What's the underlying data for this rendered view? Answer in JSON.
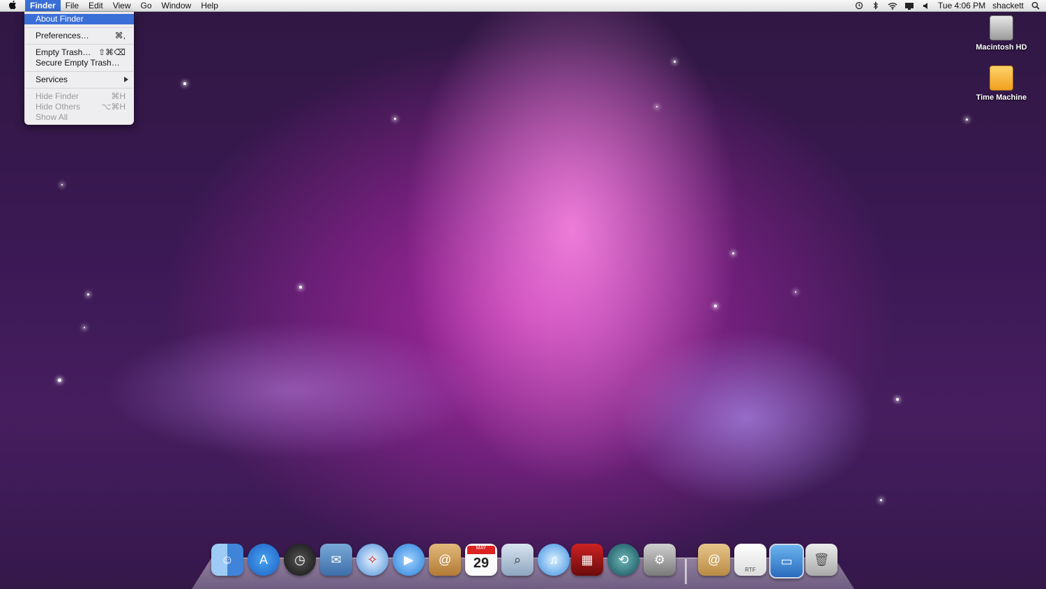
{
  "menubar": {
    "apple": "",
    "items": [
      "Finder",
      "File",
      "Edit",
      "View",
      "Go",
      "Window",
      "Help"
    ],
    "clock": "Tue 4:06 PM",
    "user": "shackett",
    "status_icons": [
      "time-machine-icon",
      "bluetooth-icon",
      "wifi-icon",
      "display-icon",
      "volume-icon",
      "spotlight-icon"
    ]
  },
  "finder_menu": {
    "about": "About Finder",
    "preferences": "Preferences…",
    "preferences_sc": "⌘,",
    "empty_trash": "Empty Trash…",
    "empty_trash_sc": "⇧⌘⌫",
    "secure_empty_trash": "Secure Empty Trash…",
    "services": "Services",
    "hide_finder": "Hide Finder",
    "hide_finder_sc": "⌘H",
    "hide_others": "Hide Others",
    "hide_others_sc": "⌥⌘H",
    "show_all": "Show All"
  },
  "desktop": {
    "hd_label": "Macintosh HD",
    "tm_label": "Time Machine"
  },
  "dock": {
    "calendar_month": "MAY",
    "calendar_day": "29",
    "rtf_label": "RTF",
    "colors": {
      "accent": "#3a6fd8"
    }
  }
}
